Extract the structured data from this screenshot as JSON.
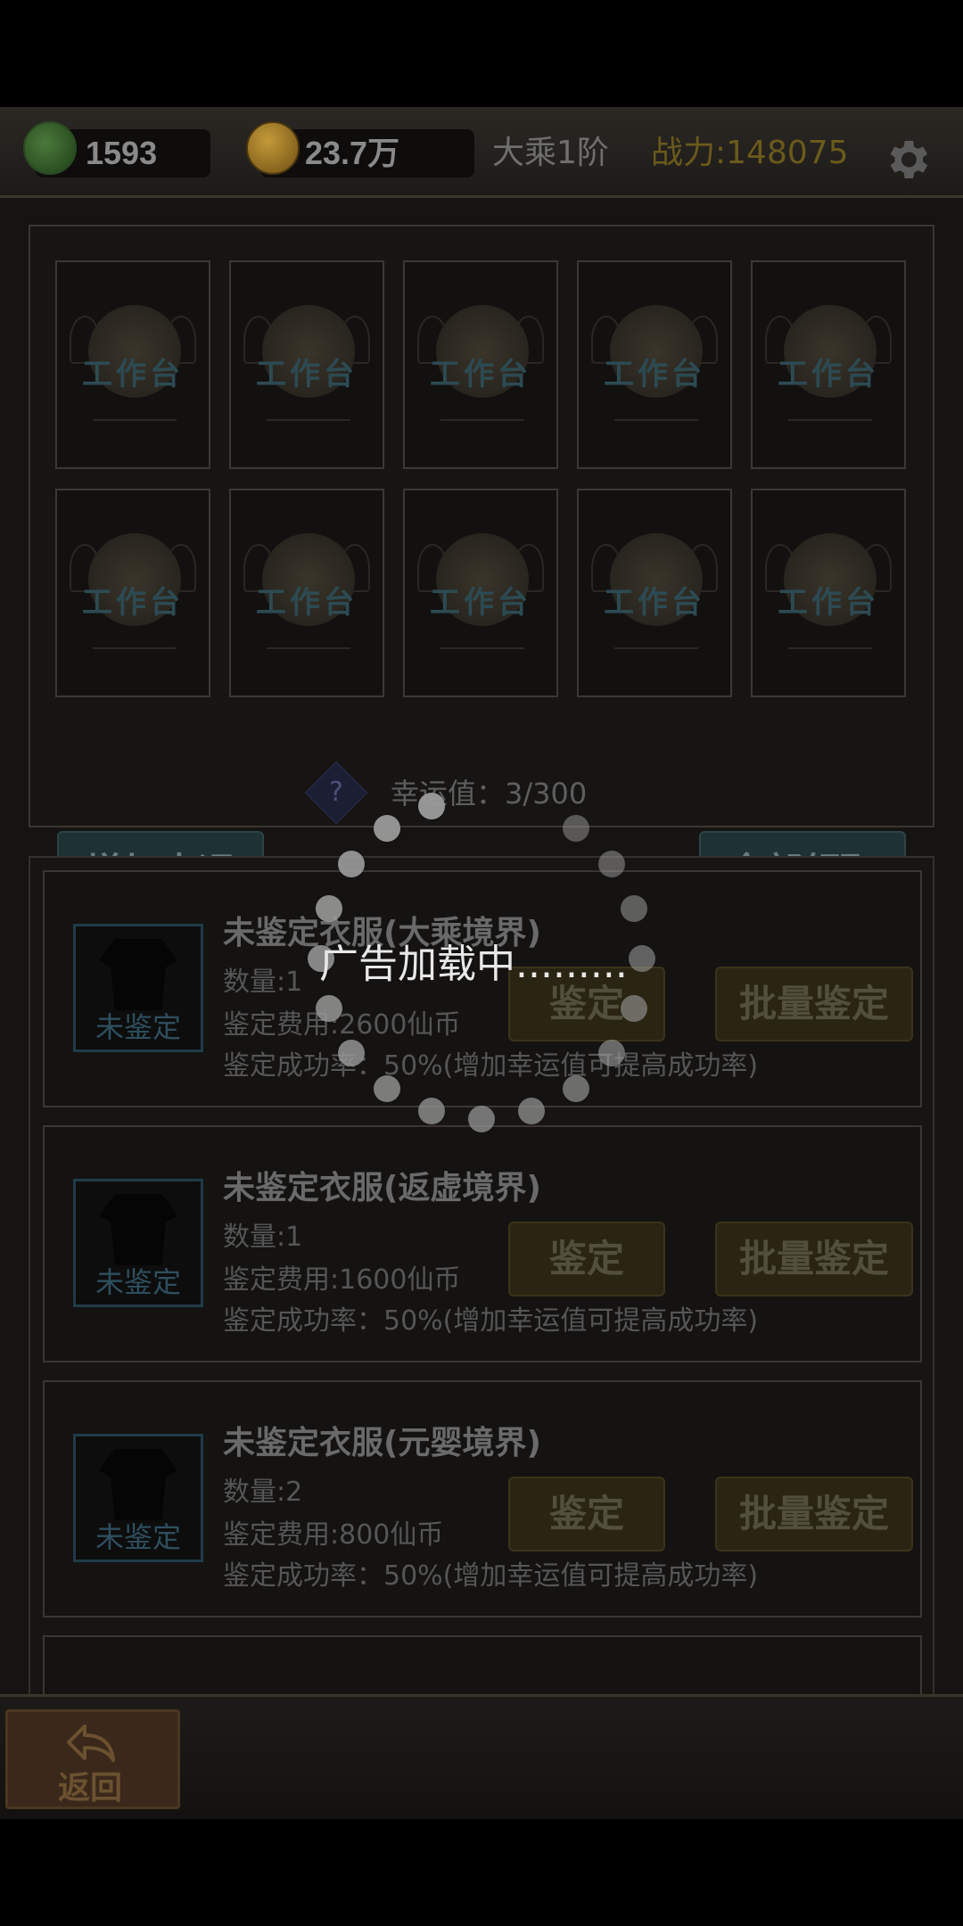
{
  "topbar": {
    "jade_value": "1593",
    "coin_value": "23.7万",
    "realm": "大乘1阶",
    "power": "战力:148075",
    "settings_icon": "gear-icon"
  },
  "workbench": {
    "slot_label": "工作台",
    "slots": [
      "工作台",
      "工作台",
      "工作台",
      "工作台",
      "工作台",
      "工作台",
      "工作台",
      "工作台",
      "工作台",
      "工作台"
    ],
    "add_luck_label": "增加幸运",
    "help_label": "?",
    "luck_text": "幸运值：3/300",
    "collect_all_label": "全部领取"
  },
  "items": [
    {
      "thumb_label": "未鉴定",
      "name": "未鉴定衣服(大乘境界)",
      "quantity": "数量:1",
      "cost": "鉴定费用:2600仙币",
      "rate": "鉴定成功率：50%(增加幸运值可提高成功率)",
      "identify_label": "鉴定",
      "batch_label": "批量鉴定"
    },
    {
      "thumb_label": "未鉴定",
      "name": "未鉴定衣服(返虚境界)",
      "quantity": "数量:1",
      "cost": "鉴定费用:1600仙币",
      "rate": "鉴定成功率：50%(增加幸运值可提高成功率)",
      "identify_label": "鉴定",
      "batch_label": "批量鉴定"
    },
    {
      "thumb_label": "未鉴定",
      "name": "未鉴定衣服(元婴境界)",
      "quantity": "数量:2",
      "cost": "鉴定费用:800仙币",
      "rate": "鉴定成功率：50%(增加幸运值可提高成功率)",
      "identify_label": "鉴定",
      "batch_label": "批量鉴定"
    }
  ],
  "bottombar": {
    "back_label": "返回"
  },
  "overlay": {
    "loading_text": "广告加载中........."
  }
}
